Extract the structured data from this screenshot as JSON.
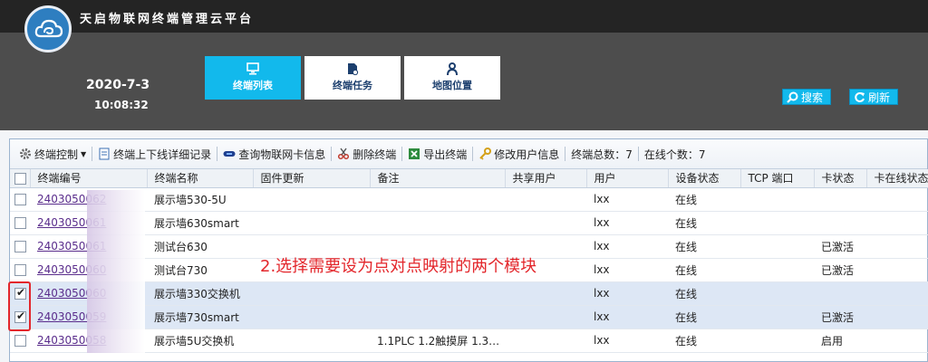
{
  "app": {
    "title": "天启物联网终端管理云平台"
  },
  "clock": {
    "date": "2020-7-3",
    "time": "10:08:32"
  },
  "nav": [
    {
      "label": "终端列表",
      "icon": "monitor-icon",
      "active": true
    },
    {
      "label": "终端任务",
      "icon": "document-icon",
      "active": false
    },
    {
      "label": "地图位置",
      "icon": "person-pin-icon",
      "active": false
    }
  ],
  "actions": {
    "search": "搜索",
    "refresh": "刷新"
  },
  "toolbar": {
    "items": [
      {
        "label": "终端控制",
        "icon": "gear-icon"
      },
      {
        "label": "终端上下线详细记录",
        "icon": "log-icon"
      },
      {
        "label": "查询物联网卡信息",
        "icon": "card-icon"
      },
      {
        "label": "删除终端",
        "icon": "scissors-icon"
      },
      {
        "label": "导出终端",
        "icon": "export-icon"
      },
      {
        "label": "修改用户信息",
        "icon": "key-icon"
      }
    ],
    "total": "终端总数：7",
    "online": "在线个数：7"
  },
  "table": {
    "columns": [
      "终端编号",
      "终端名称",
      "固件更新",
      "备注",
      "共享用户",
      "用户",
      "设备状态",
      "TCP 端口",
      "卡状态",
      "卡在线状态"
    ],
    "rows": [
      {
        "checked": false,
        "id": "2403050062",
        "name": "展示墙530-5U",
        "firmware": "",
        "note": "",
        "share": "",
        "user": "lxx",
        "status": "在线",
        "tcp": "",
        "card": "",
        "card_online": ""
      },
      {
        "checked": false,
        "id": "2403050061",
        "name": "展示墙630smart",
        "firmware": "",
        "note": "",
        "share": "",
        "user": "lxx",
        "status": "在线",
        "tcp": "",
        "card": "",
        "card_online": ""
      },
      {
        "checked": false,
        "id": "2403050061",
        "name": "测试台630",
        "firmware": "",
        "note": "",
        "share": "",
        "user": "lxx",
        "status": "在线",
        "tcp": "",
        "card": "已激活",
        "card_online": ""
      },
      {
        "checked": false,
        "id": "2403050060",
        "name": "测试台730",
        "firmware": "",
        "note": "",
        "share": "",
        "user": "lxx",
        "status": "在线",
        "tcp": "",
        "card": "已激活",
        "card_online": ""
      },
      {
        "checked": true,
        "id": "2403050060",
        "name": "展示墙330交换机",
        "firmware": "",
        "note": "",
        "share": "",
        "user": "lxx",
        "status": "在线",
        "tcp": "",
        "card": "",
        "card_online": ""
      },
      {
        "checked": true,
        "id": "2403050059",
        "name": "展示墙730smart",
        "firmware": "",
        "note": "",
        "share": "",
        "user": "lxx",
        "status": "在线",
        "tcp": "",
        "card": "已激活",
        "card_online": ""
      },
      {
        "checked": false,
        "id": "2403050058",
        "name": "展示墙5U交换机",
        "firmware": "",
        "note": "1.1PLC 1.2触摸屏 1.3…",
        "share": "",
        "user": "lxx",
        "status": "在线",
        "tcp": "",
        "card": "启用",
        "card_online": ""
      }
    ]
  },
  "annotation": {
    "text": "2.选择需要设为点对点映射的两个模块",
    "color": "#e3262b"
  },
  "colors": {
    "accent": "#12b9ec",
    "topbar": "#242424",
    "header": "#4d4d4d",
    "link": "#5a2d8c"
  }
}
